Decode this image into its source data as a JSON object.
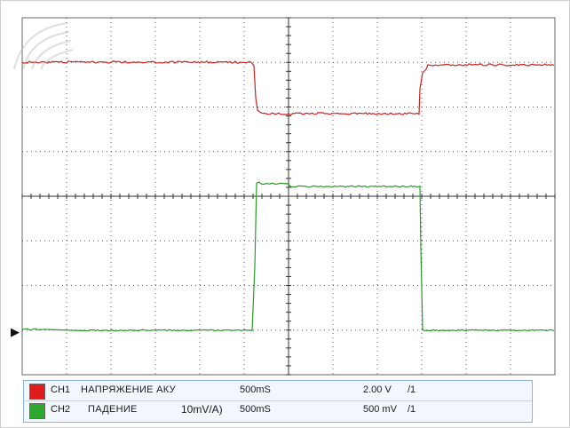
{
  "watermark": {
    "icon": "site-logo-watermark"
  },
  "channels": [
    {
      "id": "CH1",
      "label": "НАПРЯЖЕНИЕ АКУ",
      "extra": "",
      "timebase": "500mS",
      "volts_div": "2.00 V",
      "probe": "/1",
      "color": "#cc2222"
    },
    {
      "id": "CH2",
      "label": "ПАДЕНИЕ",
      "extra": "10mV/A)",
      "timebase": "500mS",
      "volts_div": "500 mV",
      "probe": "/1",
      "color": "#2a9a2a"
    }
  ],
  "trigger_marker": "▶"
}
